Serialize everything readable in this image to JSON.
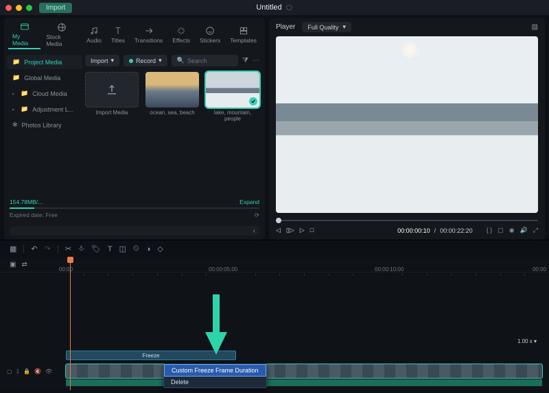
{
  "titlebar": {
    "import": "Import",
    "title": "Untitled"
  },
  "tabs": {
    "my_media": "My Media",
    "stock": "Stock Media",
    "audio": "Audio",
    "titles": "Titles",
    "transitions": "Transitions",
    "effects": "Effects",
    "stickers": "Stickers",
    "templates": "Templates"
  },
  "sidebar": {
    "items": [
      {
        "label": "Project Media"
      },
      {
        "label": "Global Media"
      },
      {
        "label": "Cloud Media"
      },
      {
        "label": "Adjustment L..."
      },
      {
        "label": "Photos Library"
      }
    ]
  },
  "actions": {
    "import": "Import",
    "record": "Record",
    "search_placeholder": "Search"
  },
  "thumbs": {
    "import_label": "Import Media",
    "a": "ocean, sea, beach",
    "b": "lake, mountain, people"
  },
  "storage": {
    "used": "154.78MB/...",
    "expand": "Expand",
    "expired": "Expired date: Free"
  },
  "player": {
    "label": "Player",
    "quality": "Full Quality",
    "current": "00:00:00:10",
    "sep": "/",
    "total": "00:00:22:20"
  },
  "timeline": {
    "t0": "00:00",
    "t5": "00:00:05:00",
    "t10": "00:00:10:00",
    "t15": "00:00",
    "freeze_label": "Freeze",
    "speed": "1.00 x",
    "track_id": "1"
  },
  "context_menu": {
    "custom": "Custom Freeze Frame Duration",
    "delete": "Delete"
  }
}
